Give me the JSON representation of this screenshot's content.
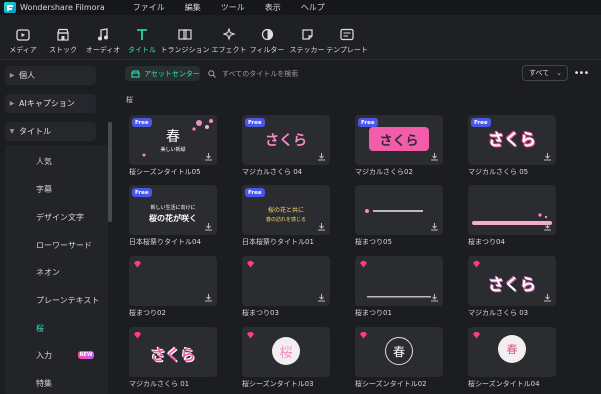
{
  "app": {
    "name": "Wondershare Filmora"
  },
  "menu": [
    "ファイル",
    "編集",
    "ツール",
    "表示",
    "ヘルプ"
  ],
  "toolbar": [
    {
      "label": "メディア",
      "icon": "media-icon"
    },
    {
      "label": "ストック",
      "icon": "stock-icon"
    },
    {
      "label": "オーディオ",
      "icon": "audio-icon"
    },
    {
      "label": "タイトル",
      "icon": "title-icon",
      "active": true
    },
    {
      "label": "トランジション",
      "icon": "transition-icon"
    },
    {
      "label": "エフェクト",
      "icon": "effect-icon"
    },
    {
      "label": "フィルター",
      "icon": "filter-icon"
    },
    {
      "label": "ステッカー",
      "icon": "sticker-icon"
    },
    {
      "label": "テンプレート",
      "icon": "template-icon"
    }
  ],
  "sidebar": {
    "groups": [
      "個人",
      "AIキャプション",
      "タイトル"
    ],
    "items": [
      "人気",
      "字幕",
      "デザイン文字",
      "ローワーサード",
      "ネオン",
      "プレーンテキスト",
      "桜",
      "入力",
      "特集"
    ],
    "active_item": "桜",
    "new_badge": "NEW"
  },
  "main": {
    "asset_center": "アセットセンター",
    "search_placeholder": "すべてのタイトルを検索",
    "filter": "すべて",
    "section": "桜",
    "free_label": "Free",
    "cards": [
      {
        "caption": "桜シーズンタイトル05",
        "badge": "free"
      },
      {
        "caption": "マジカルさくら 04",
        "badge": "free"
      },
      {
        "caption": "マジカルさくら02",
        "badge": "free"
      },
      {
        "caption": "マジカルさくら 05",
        "badge": "free"
      },
      {
        "caption": "日本桜祭りタイトル04",
        "badge": "free"
      },
      {
        "caption": "日本桜祭りタイトル01",
        "badge": "free"
      },
      {
        "caption": "桜まつり05",
        "badge": "none"
      },
      {
        "caption": "桜まつり04",
        "badge": "none"
      },
      {
        "caption": "桜まつり02",
        "badge": "gem"
      },
      {
        "caption": "桜まつり03",
        "badge": "gem"
      },
      {
        "caption": "桜まつり01",
        "badge": "gem"
      },
      {
        "caption": "マジカルさくら 03",
        "badge": "gem"
      },
      {
        "caption": "マジカルさくら 01",
        "badge": "gem"
      },
      {
        "caption": "桜シーズンタイトル03",
        "badge": "gem"
      },
      {
        "caption": "桜シーズンタイトル02",
        "badge": "gem"
      },
      {
        "caption": "桜シーズンタイトル04",
        "badge": "gem"
      }
    ],
    "thumb_text": {
      "haru": "春",
      "sakura": "さくら",
      "pink_sakura": "桜",
      "line1": "新しい生活に向けに",
      "line2": "桜の花が咲く",
      "line3": "桜の花と共に",
      "line4": "春の訪れを感じる",
      "line5": "美しい新緑"
    }
  },
  "colors": {
    "accent": "#2ee6c6",
    "free_badge": "#4a57e8",
    "gem": "#ff3d7f",
    "pink": "#f48cc8"
  }
}
